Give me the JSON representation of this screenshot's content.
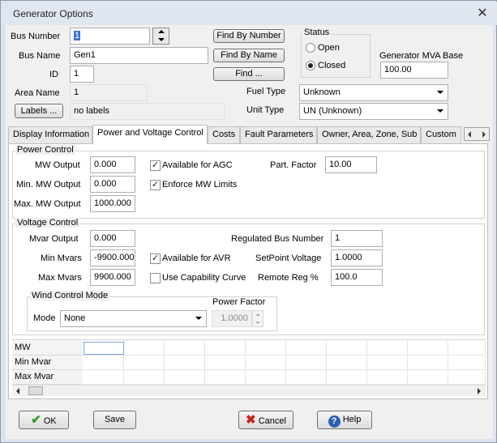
{
  "window": {
    "title": "Generator Options",
    "close_icon": "close-icon"
  },
  "bus": {
    "number_label": "Bus Number",
    "number_value": "1",
    "name_label": "Bus Name",
    "name_value": "Gen1",
    "id_label": "ID",
    "id_value": "1",
    "area_label": "Area Name",
    "area_value": "1",
    "labels_button": "Labels ...",
    "labels_value": "no labels"
  },
  "find": {
    "by_number": "Find By Number",
    "by_name": "Find By Name",
    "find": "Find ..."
  },
  "status": {
    "title": "Status",
    "open": "Open",
    "closed": "Closed",
    "selected": "Closed"
  },
  "mva": {
    "label": "Generator MVA Base",
    "value": "100.00"
  },
  "fuel": {
    "label": "Fuel Type",
    "value": "Unknown"
  },
  "unit": {
    "label": "Unit Type",
    "value": "UN (Unknown)"
  },
  "tabs": [
    {
      "label": "Display Information",
      "active": false
    },
    {
      "label": "Power and Voltage Control",
      "active": true
    },
    {
      "label": "Costs",
      "active": false
    },
    {
      "label": "Fault Parameters",
      "active": false
    },
    {
      "label": "Owner, Area, Zone, Sub",
      "active": false
    },
    {
      "label": "Custom",
      "active": false
    }
  ],
  "power_control": {
    "title": "Power Control",
    "mw_output_label": "MW Output",
    "mw_output": "0.000",
    "min_mw_label": "Min. MW Output",
    "min_mw": "0.000",
    "max_mw_label": "Max. MW Output",
    "max_mw": "1000.000",
    "agc_label": "Available for AGC",
    "agc_checked": true,
    "enforce_label": "Enforce MW Limits",
    "enforce_checked": true,
    "part_factor_label": "Part. Factor",
    "part_factor": "10.00"
  },
  "voltage_control": {
    "title": "Voltage Control",
    "mvar_output_label": "Mvar Output",
    "mvar_output": "0.000",
    "min_mvars_label": "Min Mvars",
    "min_mvars": "-9900.000",
    "max_mvars_label": "Max Mvars",
    "max_mvars": "9900.000",
    "avr_label": "Available for AVR",
    "avr_checked": true,
    "capability_label": "Use Capability Curve",
    "capability_checked": false,
    "reg_bus_label": "Regulated Bus Number",
    "reg_bus": "1",
    "setpoint_label": "SetPoint Voltage",
    "setpoint": "1.0000",
    "remote_reg_label": "Remote Reg %",
    "remote_reg": "100.0"
  },
  "wind": {
    "title": "Wind Control Mode",
    "mode_label": "Mode",
    "mode_value": "None",
    "pf_label": "Power Factor",
    "pf_value": "1.0000"
  },
  "grid": {
    "rows": [
      "MW",
      "Min Mvar",
      "Max Mvar"
    ]
  },
  "buttons": {
    "ok": "OK",
    "save": "Save",
    "cancel": "Cancel",
    "help": "Help"
  },
  "colors": {
    "ok_check": "#2e9a2e",
    "cancel_x": "#c0281e",
    "help": "#2f5fb0"
  }
}
